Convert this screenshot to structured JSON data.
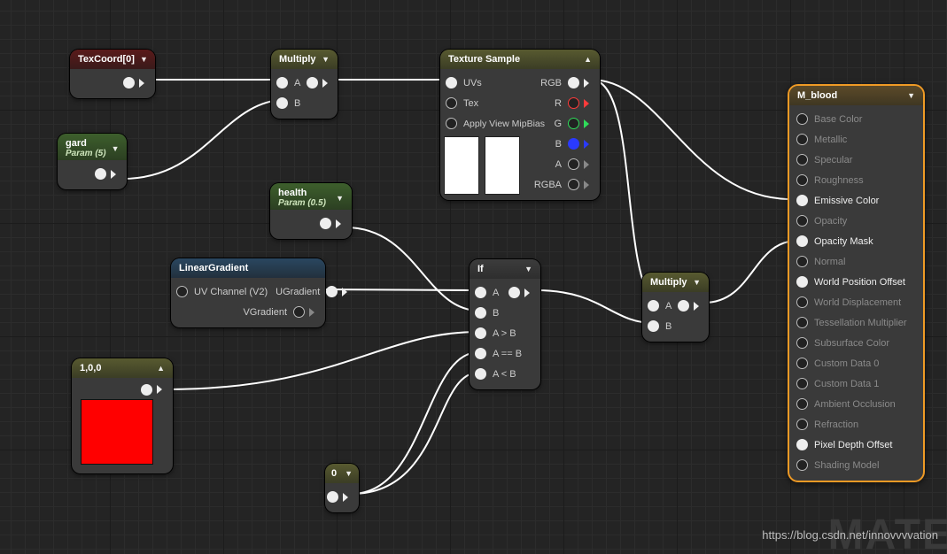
{
  "nodes": {
    "texcoord": {
      "title": "TexCoord[0]"
    },
    "gard": {
      "title": "gard",
      "sub": "Param (5)"
    },
    "multiply1": {
      "title": "Multiply",
      "inputs": [
        "A",
        "B"
      ]
    },
    "health": {
      "title": "health",
      "sub": "Param (0.5)"
    },
    "lineargradient": {
      "title": "LinearGradient",
      "in": "UV Channel (V2)",
      "out": [
        "UGradient",
        "VGradient"
      ]
    },
    "const100": {
      "title": "1,0,0"
    },
    "const0": {
      "title": "0"
    },
    "texturesample": {
      "title": "Texture Sample",
      "inputs": [
        "UVs",
        "Tex",
        "Apply View MipBias"
      ],
      "outputs": [
        "RGB",
        "R",
        "G",
        "B",
        "A",
        "RGBA"
      ]
    },
    "if": {
      "title": "If",
      "inputs": [
        "A",
        "B",
        "A > B",
        "A == B",
        "A < B"
      ]
    },
    "multiply2": {
      "title": "Multiply",
      "inputs": [
        "A",
        "B"
      ]
    }
  },
  "result": {
    "title": "M_blood",
    "items": [
      {
        "label": "Base Color",
        "active": false
      },
      {
        "label": "Metallic",
        "active": false
      },
      {
        "label": "Specular",
        "active": false
      },
      {
        "label": "Roughness",
        "active": false
      },
      {
        "label": "Emissive Color",
        "active": true
      },
      {
        "label": "Opacity",
        "active": false
      },
      {
        "label": "Opacity Mask",
        "active": true
      },
      {
        "label": "Normal",
        "active": false
      },
      {
        "label": "World Position Offset",
        "active": true
      },
      {
        "label": "World Displacement",
        "active": false
      },
      {
        "label": "Tessellation Multiplier",
        "active": false
      },
      {
        "label": "Subsurface Color",
        "active": false
      },
      {
        "label": "Custom Data 0",
        "active": false
      },
      {
        "label": "Custom Data 1",
        "active": false
      },
      {
        "label": "Ambient Occlusion",
        "active": false
      },
      {
        "label": "Refraction",
        "active": false
      },
      {
        "label": "Pixel Depth Offset",
        "active": true
      },
      {
        "label": "Shading Model",
        "active": false
      }
    ]
  },
  "watermark": "https://blog.csdn.net/innovvvvation",
  "bigtext": "MATE"
}
